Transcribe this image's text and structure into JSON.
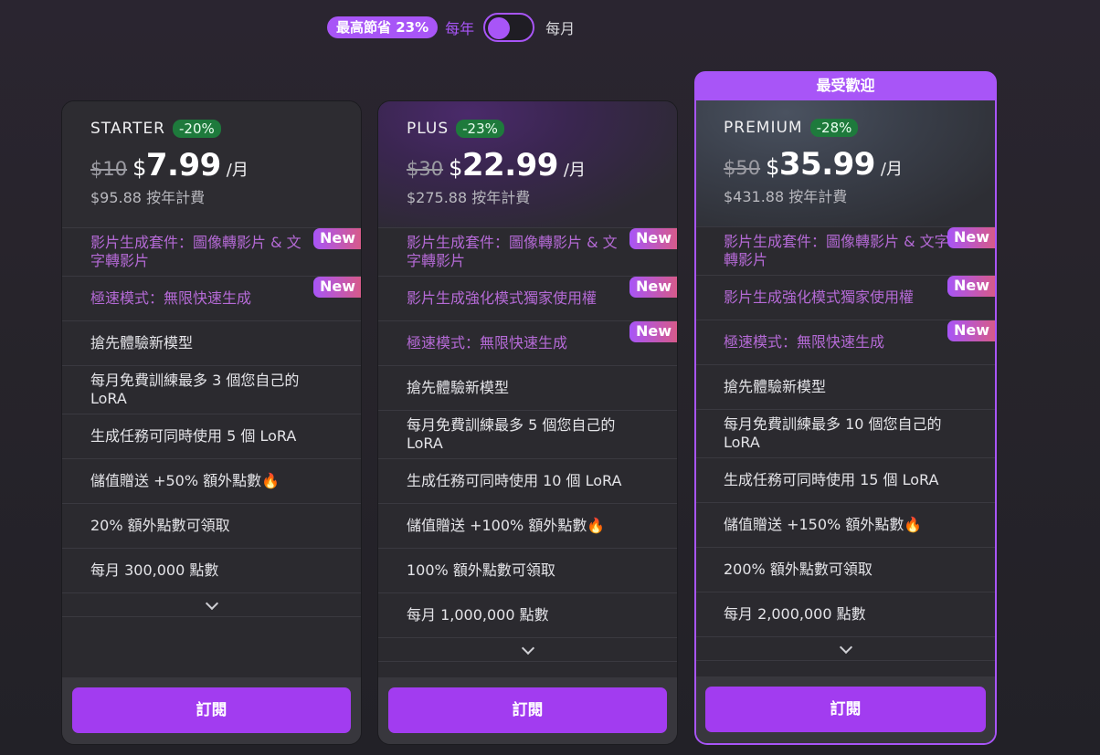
{
  "billing": {
    "save_badge": "最高節省 23%",
    "yearly_label": "每年",
    "monthly_label": "每月",
    "toggle_state": "yearly"
  },
  "popular_banner": "最受歡迎",
  "new_tag": "New",
  "subscribe_label": "訂閱",
  "plans": [
    {
      "name": "STARTER",
      "discount": "-20%",
      "old_price": "$10",
      "currency": "$",
      "price": "7.99",
      "per": "/月",
      "yearly_total": "$95.88 按年計費",
      "features": [
        {
          "text": "影片生成套件：圖像轉影片 & 文字轉影片",
          "highlight": true,
          "new": true
        },
        {
          "text": "極速模式：無限快速生成",
          "highlight": true,
          "new": true
        },
        {
          "text": "搶先體驗新模型",
          "highlight": false,
          "new": false
        },
        {
          "text": "每月免費訓練最多 3 個您自己的 LoRA",
          "highlight": false,
          "new": false
        },
        {
          "text": "生成任務可同時使用 5 個 LoRA",
          "highlight": false,
          "new": false
        },
        {
          "text": "儲值贈送 +50% 額外點數",
          "highlight": false,
          "new": false,
          "flame": true
        },
        {
          "text": "20% 額外點數可領取",
          "highlight": false,
          "new": false
        },
        {
          "text": "每月 300,000 點數",
          "highlight": false,
          "new": false
        }
      ]
    },
    {
      "name": "PLUS",
      "discount": "-23%",
      "old_price": "$30",
      "currency": "$",
      "price": "22.99",
      "per": "/月",
      "yearly_total": "$275.88 按年計費",
      "features": [
        {
          "text": "影片生成套件：圖像轉影片 & 文字轉影片",
          "highlight": true,
          "new": true
        },
        {
          "text": "影片生成強化模式獨家使用權",
          "highlight": true,
          "new": true
        },
        {
          "text": "極速模式：無限快速生成",
          "highlight": true,
          "new": true
        },
        {
          "text": "搶先體驗新模型",
          "highlight": false,
          "new": false
        },
        {
          "text": "每月免費訓練最多 5 個您自己的 LoRA",
          "highlight": false,
          "new": false
        },
        {
          "text": "生成任務可同時使用 10 個 LoRA",
          "highlight": false,
          "new": false
        },
        {
          "text": "儲值贈送 +100% 額外點數",
          "highlight": false,
          "new": false,
          "flame": true
        },
        {
          "text": "100% 額外點數可領取",
          "highlight": false,
          "new": false
        },
        {
          "text": "每月 1,000,000 點數",
          "highlight": false,
          "new": false
        }
      ]
    },
    {
      "name": "PREMIUM",
      "discount": "-28%",
      "old_price": "$50",
      "currency": "$",
      "price": "35.99",
      "per": "/月",
      "yearly_total": "$431.88 按年計費",
      "features": [
        {
          "text": "影片生成套件：圖像轉影片 & 文字轉影片",
          "highlight": true,
          "new": true
        },
        {
          "text": "影片生成強化模式獨家使用權",
          "highlight": true,
          "new": true
        },
        {
          "text": "極速模式：無限快速生成",
          "highlight": true,
          "new": true
        },
        {
          "text": "搶先體驗新模型",
          "highlight": false,
          "new": false
        },
        {
          "text": "每月免費訓練最多 10 個您自己的 LoRA",
          "highlight": false,
          "new": false
        },
        {
          "text": "生成任務可同時使用 15 個 LoRA",
          "highlight": false,
          "new": false
        },
        {
          "text": "儲值贈送 +150% 額外點數",
          "highlight": false,
          "new": false,
          "flame": true
        },
        {
          "text": "200% 額外點數可領取",
          "highlight": false,
          "new": false
        },
        {
          "text": "每月 2,000,000 點數",
          "highlight": false,
          "new": false
        }
      ]
    }
  ]
}
